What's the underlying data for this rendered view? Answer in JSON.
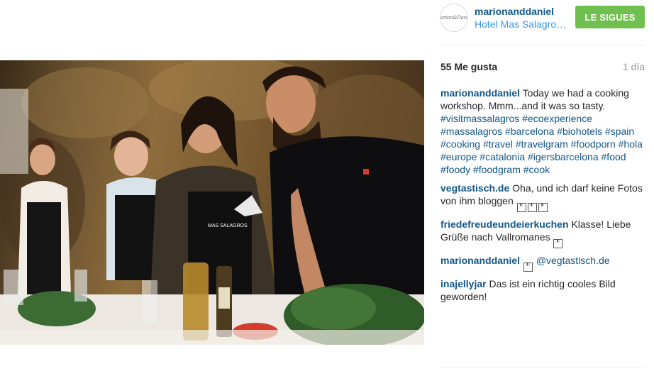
{
  "post": {
    "username": "marionanddaniel",
    "location": "Hotel Mas Salagros EcoResort",
    "follow_label": "LE SIGUES",
    "avatar_text": "Marion&Daniel",
    "likes": "55 Me gusta",
    "time": "1 día",
    "accent_color": "#70c050",
    "link_color": "#125688"
  },
  "photo": {
    "apron_text": "MAS SALAGROS"
  },
  "caption": {
    "user": "marionanddaniel",
    "text": "Today we had a cooking workshop. Mmm...and it was so tasty.",
    "hashtags": [
      "#visitmassalagros",
      "#ecoexperience",
      "#massalagros",
      "#barcelona",
      "#biohotels",
      "#spain",
      "#cooking",
      "#travel",
      "#travelgram",
      "#foodporn",
      "#hola",
      "#europe",
      "#catalonia",
      "#igersbarcelona",
      "#food",
      "#foody",
      "#foodgram",
      "#cook"
    ]
  },
  "comments": [
    {
      "user": "vegtastisch.de",
      "text": "Oha, und ich darf keine Fotos von ihm bloggen",
      "emoji": [
        "emoji-1",
        "emoji-2",
        "emoji-3"
      ]
    },
    {
      "user": "friedefreudeundeierkuchen",
      "text": "Klasse! Liebe Grüße nach Vallromanes",
      "emoji": [
        "emoji-1"
      ]
    },
    {
      "user": "marionanddaniel",
      "text": "@vegtastisch.de",
      "emoji_before": [
        "emoji-1"
      ]
    },
    {
      "user": "inajellyjar",
      "text": "Das ist ein richtig cooles Bild geworden!",
      "emoji": []
    }
  ]
}
